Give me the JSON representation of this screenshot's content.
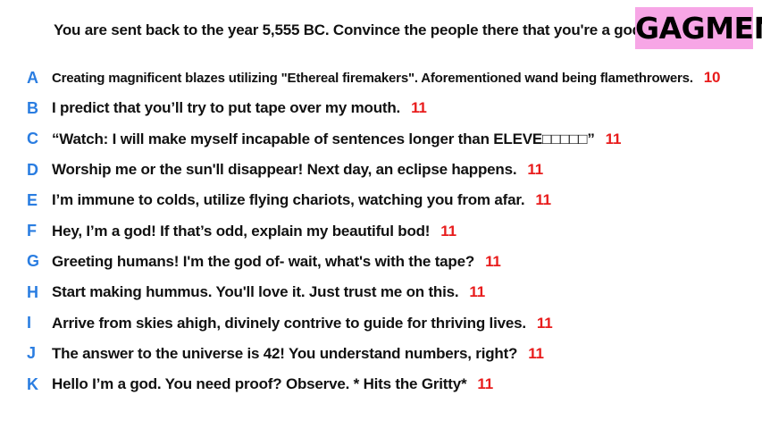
{
  "prompt": "You are sent back to the year 5,555 BC. Convince the people there that you're a god.",
  "logo": "GAGMEN",
  "colors": {
    "letter": "#2a7de1",
    "score": "#e81c1c",
    "logo_bg": "#f7a6e6"
  },
  "answers": [
    {
      "letter": "A",
      "text": "Creating magnificent blazes utilizing \"Ethereal firemakers\". Aforementioned wand being flamethrowers.",
      "score": "10"
    },
    {
      "letter": "B",
      "text": "I predict that you’ll try to put tape over my mouth.",
      "score": "11"
    },
    {
      "letter": "C",
      "text": "“Watch: I will make myself incapable of sentences longer than ELEVE□□□□□”",
      "score": "11"
    },
    {
      "letter": "D",
      "text": "Worship me or the sun'll disappear! Next day, an eclipse happens.",
      "score": "11"
    },
    {
      "letter": "E",
      "text": "I’m immune to colds, utilize flying chariots, watching you from afar.",
      "score": "11"
    },
    {
      "letter": "F",
      "text": "Hey, I’m a god! If that’s odd, explain my beautiful bod!",
      "score": "11"
    },
    {
      "letter": "G",
      "text": "Greeting humans! I'm the god of- wait, what's with the tape?",
      "score": "11"
    },
    {
      "letter": "H",
      "text": "Start making hummus. You'll love it. Just trust me on this.",
      "score": "11"
    },
    {
      "letter": "I",
      "text": "Arrive from skies ahigh, divinely contrive to guide for thriving lives.",
      "score": "11"
    },
    {
      "letter": "J",
      "text": "The answer to the universe is 42! You understand numbers, right?",
      "score": "11"
    },
    {
      "letter": "K",
      "text": "Hello I’m a god. You need proof? Observe. * Hits the Gritty*",
      "score": "11"
    }
  ]
}
